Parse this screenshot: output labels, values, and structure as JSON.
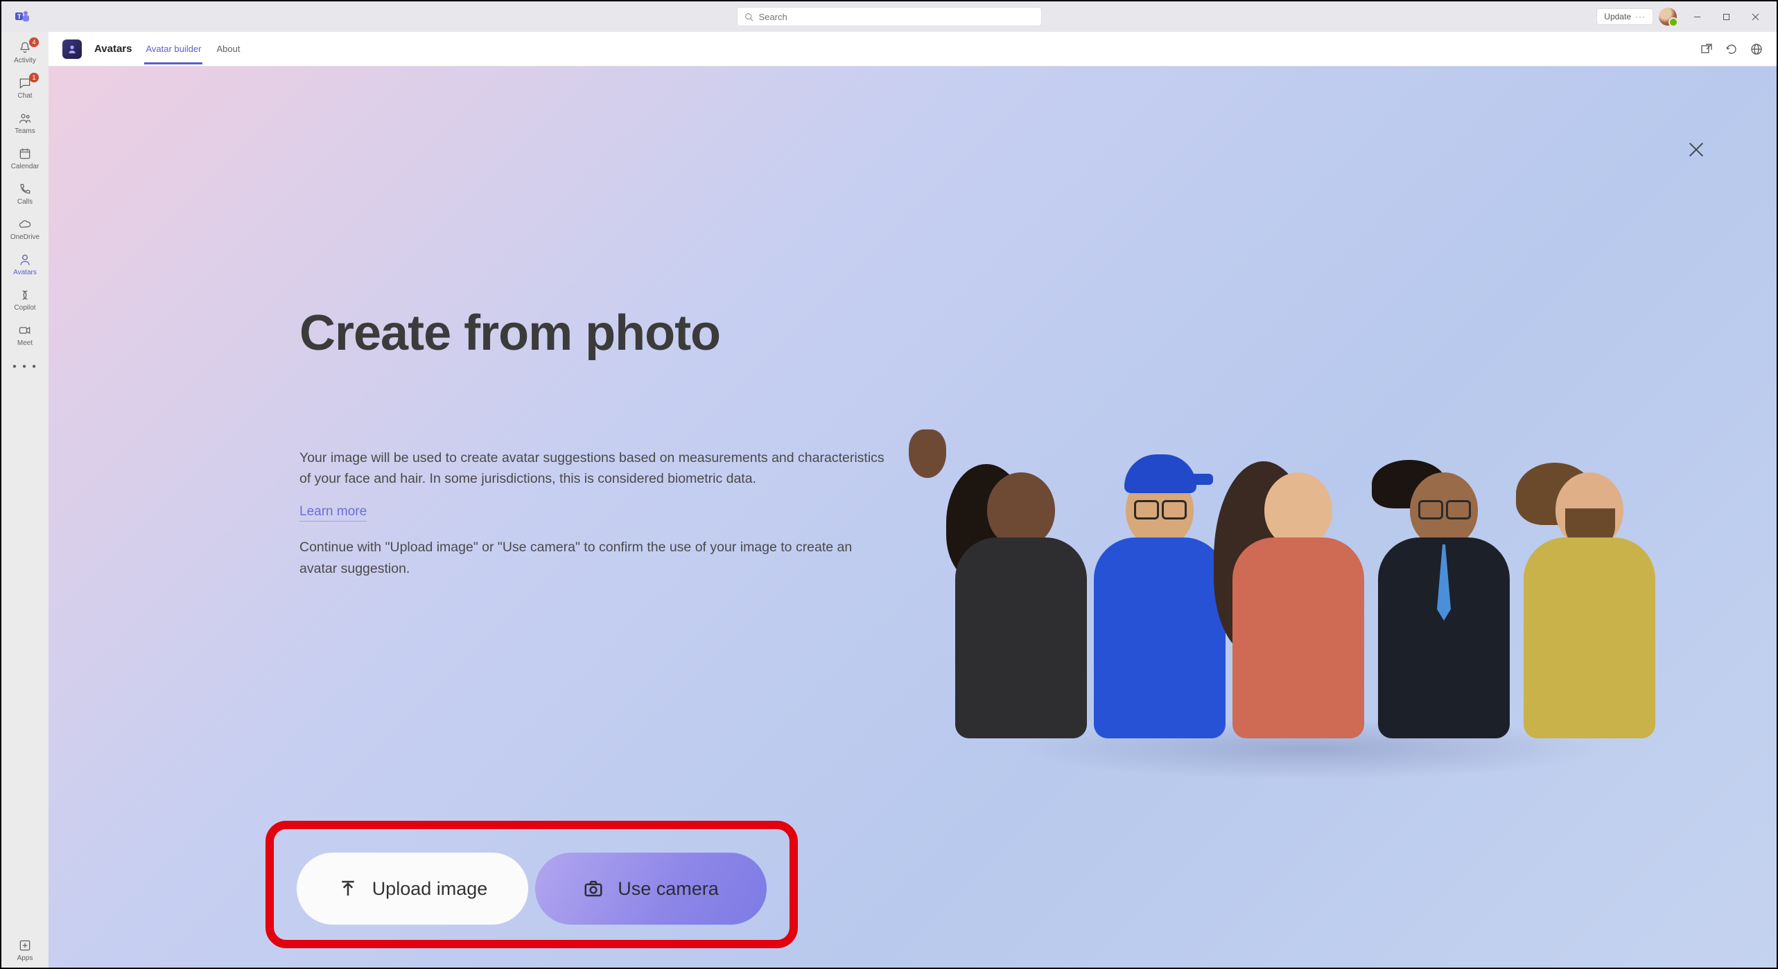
{
  "titlebar": {
    "search_placeholder": "Search",
    "update_label": "Update"
  },
  "leftrail": {
    "items": [
      {
        "label": "Activity",
        "icon": "bell-icon",
        "badge": "4"
      },
      {
        "label": "Chat",
        "icon": "chat-icon",
        "badge": "1"
      },
      {
        "label": "Teams",
        "icon": "teams-icon",
        "badge": ""
      },
      {
        "label": "Calendar",
        "icon": "calendar-icon",
        "badge": ""
      },
      {
        "label": "Calls",
        "icon": "calls-icon",
        "badge": ""
      },
      {
        "label": "OneDrive",
        "icon": "onedrive-icon",
        "badge": ""
      },
      {
        "label": "Avatars",
        "icon": "avatar-icon",
        "badge": "",
        "active": true
      },
      {
        "label": "Copilot",
        "icon": "copilot-icon",
        "badge": ""
      },
      {
        "label": "Meet",
        "icon": "meet-icon",
        "badge": ""
      }
    ],
    "apps_label": "Apps"
  },
  "apptabs": {
    "app_title": "Avatars",
    "tabs": [
      {
        "label": "Avatar builder",
        "active": true
      },
      {
        "label": "About",
        "active": false
      }
    ]
  },
  "hero": {
    "title": "Create from photo",
    "body1": "Your image will be used to create avatar suggestions based on measurements and characteristics of your face and hair. In some jurisdictions, this is considered biometric data.",
    "learn_more": "Learn more",
    "body2": "Continue with \"Upload image\" or \"Use camera\" to confirm the use of your image to create an avatar suggestion."
  },
  "buttons": {
    "upload": "Upload image",
    "camera": "Use camera"
  },
  "colors": {
    "accent": "#5b5fc7",
    "annotation": "#e3000f"
  }
}
